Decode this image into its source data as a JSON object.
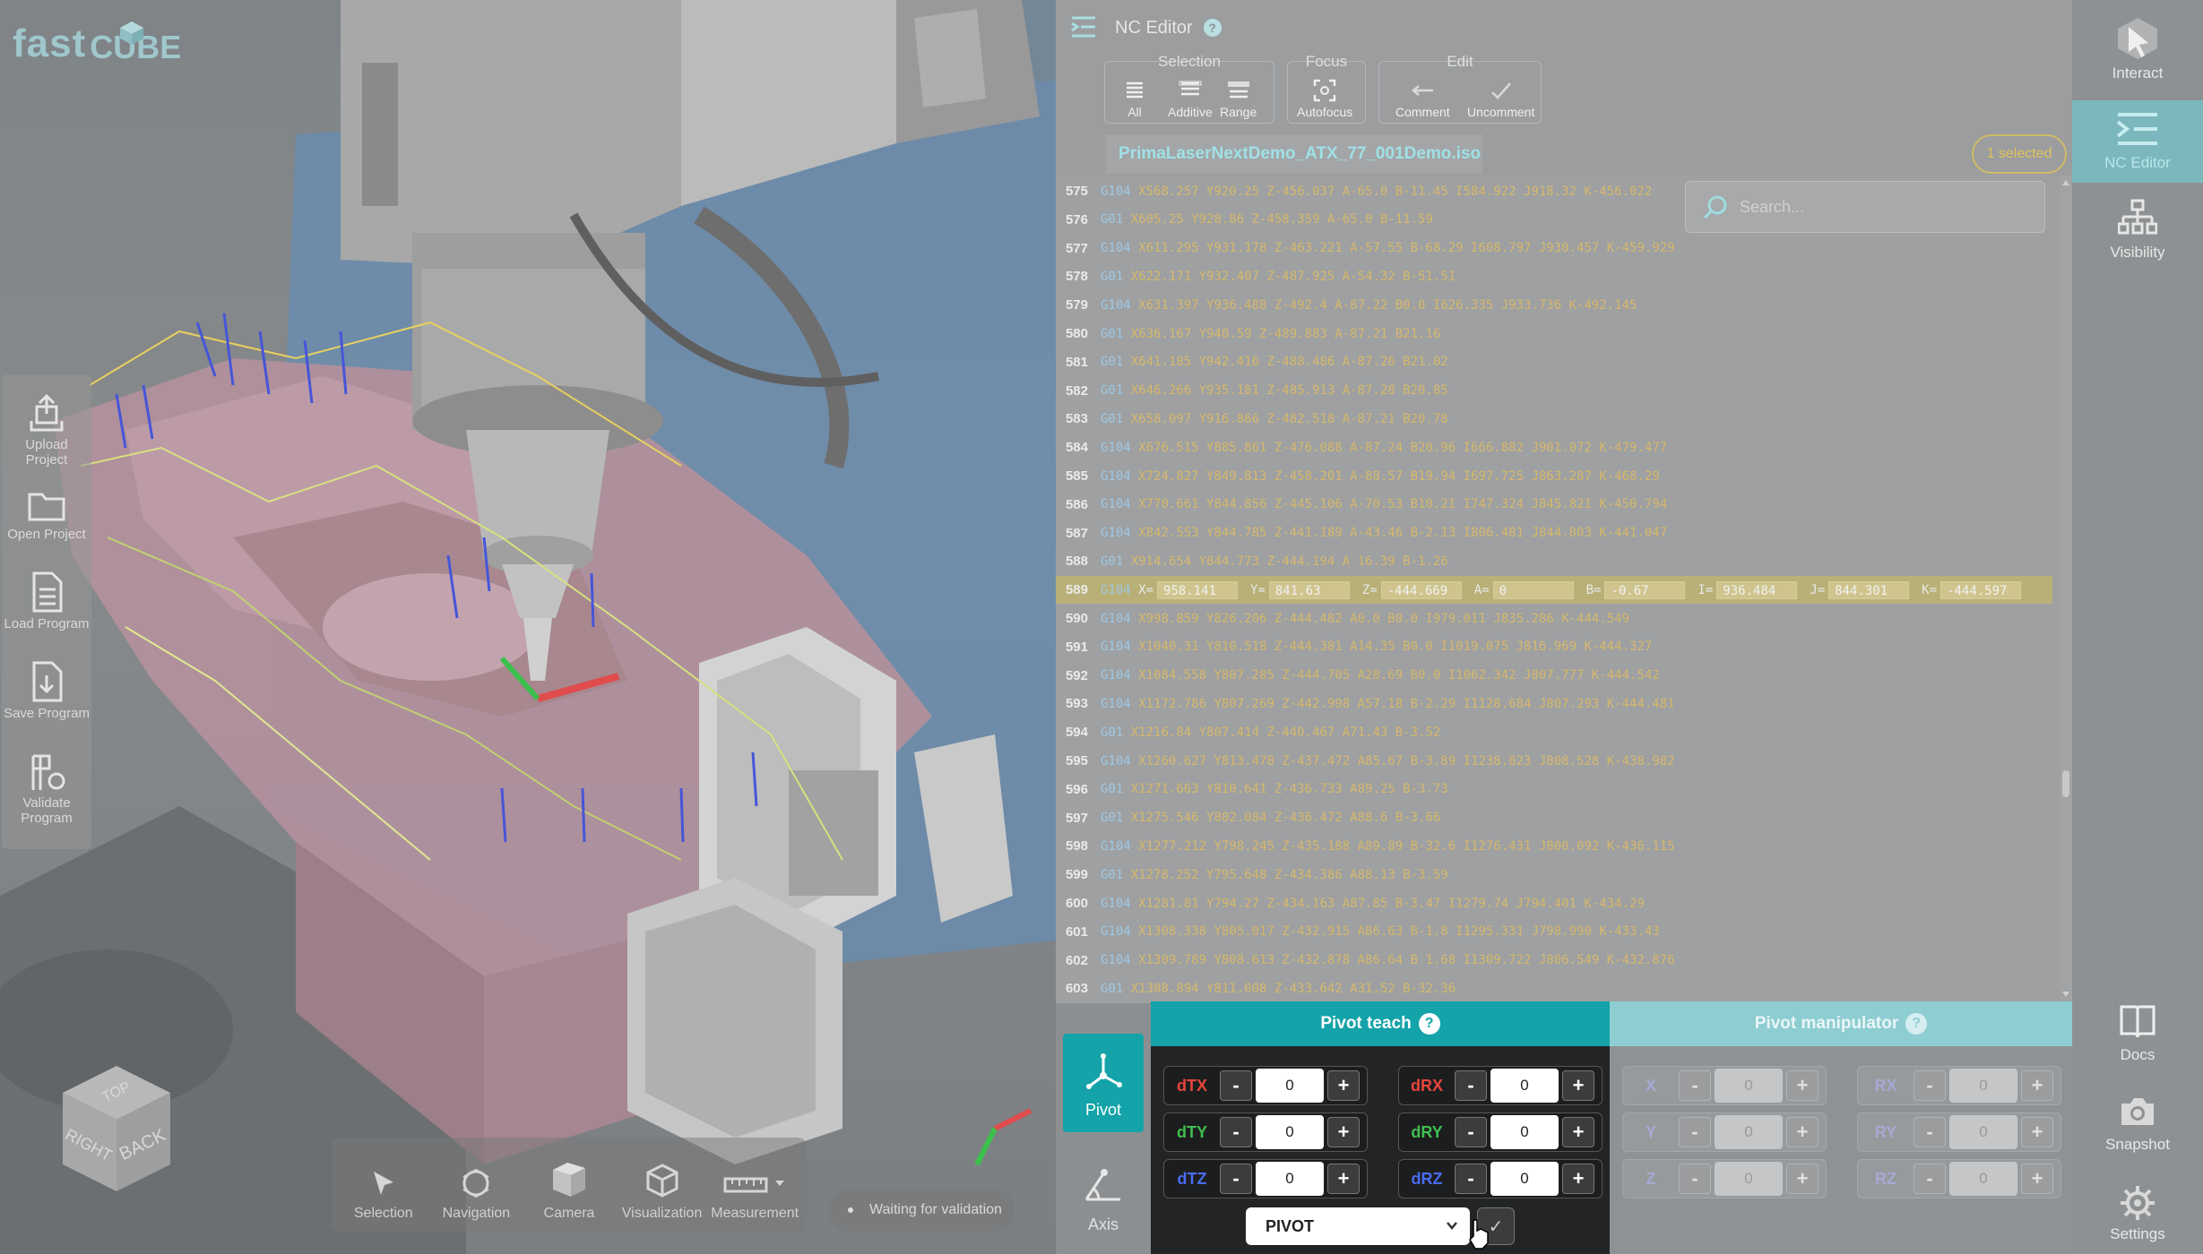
{
  "logo": {
    "part1": "fast",
    "part2": "CUBE"
  },
  "left_toolbar": [
    {
      "id": "upload",
      "label": "Upload Project",
      "icon": "upload-project-icon"
    },
    {
      "id": "open",
      "label": "Open Project",
      "icon": "folder-icon"
    },
    {
      "id": "load",
      "label": "Load Program",
      "icon": "document-icon"
    },
    {
      "id": "save",
      "label": "Save Program",
      "icon": "save-document-icon"
    },
    {
      "id": "validate",
      "label": "Validate Program",
      "icon": "validate-icon"
    }
  ],
  "bottom_toolbar": [
    {
      "label": "Selection",
      "icon": "cursor-icon"
    },
    {
      "label": "Navigation",
      "icon": "navigation-icon"
    },
    {
      "label": "Camera",
      "icon": "camera-cube-icon"
    },
    {
      "label": "Visualization",
      "icon": "visualization-cube-icon"
    },
    {
      "label": "Measurement",
      "icon": "ruler-icon"
    }
  ],
  "validation_status": "Waiting for validation",
  "view_cube": {
    "top": "TOP",
    "right": "RIGHT",
    "back": "BACK"
  },
  "nc_editor": {
    "title": "NC Editor",
    "help": "?",
    "groups": {
      "selection": {
        "title": "Selection",
        "buttons": [
          "All",
          "Additive",
          "Range"
        ]
      },
      "focus": {
        "title": "Focus",
        "buttons": [
          "Autofocus"
        ]
      },
      "edit": {
        "title": "Edit",
        "buttons": [
          "Comment",
          "Uncomment"
        ]
      }
    },
    "file_tab": "PrimaLaserNextDemo_ATX_77_001Demo.iso",
    "selected_count": "1 selected",
    "search_placeholder": "Search...",
    "highlighted_line": 589,
    "highlight_fields": [
      {
        "label": "X=",
        "value": "958.141"
      },
      {
        "label": "Y=",
        "value": "841.63"
      },
      {
        "label": "Z=",
        "value": "-444.669"
      },
      {
        "label": "A=",
        "value": "0"
      },
      {
        "label": "B=",
        "value": "-0.67"
      },
      {
        "label": "I=",
        "value": "936.484"
      },
      {
        "label": "J=",
        "value": "844.301"
      },
      {
        "label": "K=",
        "value": "-444.597"
      }
    ],
    "lines": [
      {
        "n": "575",
        "cmd": "G104",
        "text": "X568.257 Y920.25 Z-456.037 A-65.0 B-11.45 I584.922 J918.32 K-456.022"
      },
      {
        "n": "576",
        "cmd": "G01",
        "text": "X605.25 Y928.86 Z-458.359 A-65.0 B-11.59"
      },
      {
        "n": "577",
        "cmd": "G104",
        "text": "X611.295 Y931.178 Z-463.221 A-57.55 B-68.29 I608.797 J930.457 K-459.929"
      },
      {
        "n": "578",
        "cmd": "G01",
        "text": "X622.171 Y932.407 Z-487.925 A-54.32 B-51.51"
      },
      {
        "n": "579",
        "cmd": "G104",
        "text": "X631.397 Y936.488 Z-492.4 A-87.22 B0.0 I626.335 J933.736 K-492.145"
      },
      {
        "n": "580",
        "cmd": "G01",
        "text": "X636.167 Y940.59 Z-489.883 A-87.21 B21.16"
      },
      {
        "n": "581",
        "cmd": "G01",
        "text": "X641.185 Y942.416 Z-488.486 A-87.26 B21.02"
      },
      {
        "n": "582",
        "cmd": "G01",
        "text": "X646.266 Y935.181 Z-485.913 A-87.28 B20.85"
      },
      {
        "n": "583",
        "cmd": "G01",
        "text": "X658.097 Y916.866 Z-482.518 A-87.21 B20.78"
      },
      {
        "n": "584",
        "cmd": "G104",
        "text": "X676.515 Y885.861 Z-476.088 A-87.24 B20.96 I666.882 J901.072 K-479.477"
      },
      {
        "n": "585",
        "cmd": "G104",
        "text": "X724.827 Y849.813 Z-458.201 A-88.57 B19.94 I697.725 J863.287 K-468.29"
      },
      {
        "n": "586",
        "cmd": "G104",
        "text": "X770.661 Y844.856 Z-445.106 A-70.53 B10.21 I747.324 J845.821 K-450.794"
      },
      {
        "n": "587",
        "cmd": "G104",
        "text": "X842.553 Y844.785 Z-441.189 A-43.46 B-2.13 I806.481 J844.803 K-441.047"
      },
      {
        "n": "588",
        "cmd": "G01",
        "text": "X914.654 Y844.773 Z-444.194 A 16.39 B-1.26"
      },
      {
        "n": "589",
        "cmd": "G104",
        "text": ""
      },
      {
        "n": "590",
        "cmd": "G104",
        "text": "X998.859 Y826.206 Z-444.482 A0.0 B0.0 I979.011 J835.286 K-444.549"
      },
      {
        "n": "591",
        "cmd": "G104",
        "text": "X1040.31 Y810.518 Z-444.381 A14.35 B0.0 I1019.075 J816.969 K-444.327"
      },
      {
        "n": "592",
        "cmd": "G104",
        "text": "X1084.558 Y807.285 Z-444.705 A28.69 B0.0 I1062.342 J807.777 K-444.542"
      },
      {
        "n": "593",
        "cmd": "G104",
        "text": "X1172.786 Y807.269 Z-442.998 A57.18 B-2.29 I1128.684 J807.293 K-444.481"
      },
      {
        "n": "594",
        "cmd": "G01",
        "text": "X1216.84 Y807.414 Z-440.467 A71.43 B-3.52"
      },
      {
        "n": "595",
        "cmd": "G104",
        "text": "X1260.627 Y813.478 Z-437.472 A85.67 B-3.89 I1238.823 J808.528 K-438.982"
      },
      {
        "n": "596",
        "cmd": "G01",
        "text": "X1271.663 Y810.641 Z-436.733 A89.25 B-3.73"
      },
      {
        "n": "597",
        "cmd": "G01",
        "text": "X1275.546 Y802.084 Z-436.472 A88.6 B-3.66"
      },
      {
        "n": "598",
        "cmd": "G104",
        "text": "X1277.212 Y798.245 Z-435.188 A89.89 B-32.6 I1276.431 J800.092 K-436.115"
      },
      {
        "n": "599",
        "cmd": "G01",
        "text": "X1278.252 Y795.648 Z-434.386 A88.13 B-3.59"
      },
      {
        "n": "600",
        "cmd": "G104",
        "text": "X1281.81 Y794.27 Z-434.163 A87.85 B-3.47 I1279.74 J794.401 K-434.29"
      },
      {
        "n": "601",
        "cmd": "G104",
        "text": "X1308.338 Y805.017 Z-432.915 A86.63 B-1.8 I1295.331 J798.990 K-433.43"
      },
      {
        "n": "602",
        "cmd": "G104",
        "text": "X1309.789 Y808.613 Z-432.878 A86.64 B 1.68 I1309.722 J806.549 K-432.876"
      },
      {
        "n": "603",
        "cmd": "G01",
        "text": "X1308.894 Y811.008 Z-433.642 A31.52 B-32.36"
      }
    ]
  },
  "right_rail": [
    {
      "label": "Interact",
      "icon": "interact-cursor-icon"
    },
    {
      "label": "NC Editor",
      "icon": "nc-editor-icon"
    },
    {
      "label": "Visibility",
      "icon": "hierarchy-icon"
    },
    {
      "label": "Docs",
      "icon": "book-icon"
    },
    {
      "label": "Snapshot",
      "icon": "camera-icon"
    },
    {
      "label": "Settings",
      "icon": "gear-icon"
    }
  ],
  "pivot_side": [
    {
      "label": "Pivot",
      "icon": "pivot-axes-icon"
    },
    {
      "label": "Axis",
      "icon": "axis-icon"
    }
  ],
  "pivot_teach": {
    "title": "Pivot teach",
    "help": "?",
    "fields": [
      {
        "label": "dTX",
        "value": "0",
        "color": "#e8453c"
      },
      {
        "label": "dRX",
        "value": "0",
        "color": "#e8453c"
      },
      {
        "label": "dTY",
        "value": "0",
        "color": "#3fbf4f"
      },
      {
        "label": "dRY",
        "value": "0",
        "color": "#3fbf4f"
      },
      {
        "label": "dTZ",
        "value": "0",
        "color": "#4a6cf0"
      },
      {
        "label": "dRZ",
        "value": "0",
        "color": "#4a6cf0"
      }
    ],
    "minus": "-",
    "plus": "+",
    "select_value": "PIVOT",
    "ok": "✓"
  },
  "pivot_manipulator": {
    "title": "Pivot manipulator",
    "help": "?",
    "fields": [
      {
        "label": "X",
        "value": "0"
      },
      {
        "label": "RX",
        "value": "0"
      },
      {
        "label": "Y",
        "value": "0"
      },
      {
        "label": "RY",
        "value": "0"
      },
      {
        "label": "Z",
        "value": "0"
      },
      {
        "label": "RZ",
        "value": "0"
      }
    ]
  },
  "colors": {
    "accent": "#13a3a8",
    "highlight_line": "#b9b077",
    "code_text": "#d6b86a",
    "gcode_cmd": "#9fc8e4"
  }
}
